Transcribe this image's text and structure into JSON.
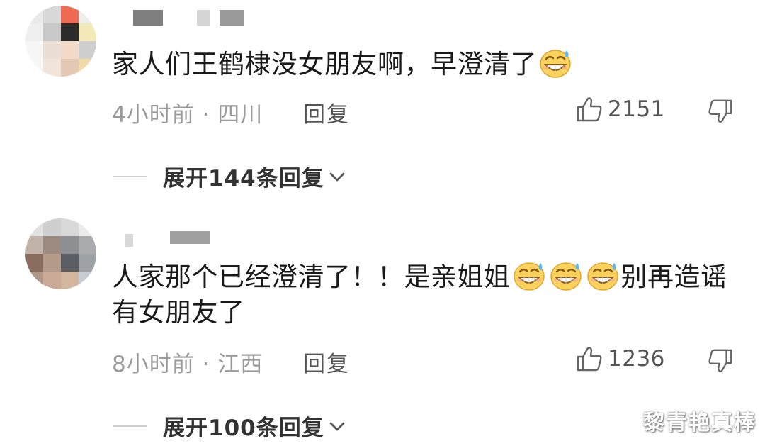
{
  "comments": [
    {
      "text": "家人们王鹤棣没女朋友啊，早澄清了",
      "time_location": "4小时前 · 四川",
      "reply_label": "回复",
      "likes": "2151",
      "expand_label": "展开144条回复"
    },
    {
      "text_part1": "人家那个已经澄清了！！是亲姐姐",
      "text_part2": "别再造谣有女朋友了",
      "time_location": "8小时前 · 江西",
      "reply_label": "回复",
      "likes": "1236",
      "expand_label": "展开100条回复"
    }
  ],
  "watermark": "黎青艳真棒",
  "icons": {
    "like": "thumbs-up-icon",
    "dislike": "thumbs-down-icon",
    "emoji": "sweat-smile-emoji",
    "expand": "chevron-down-icon"
  }
}
